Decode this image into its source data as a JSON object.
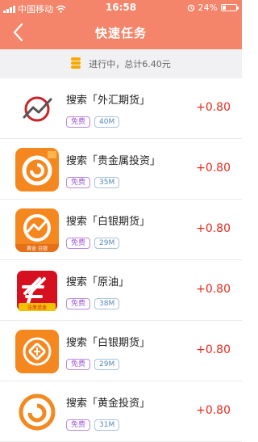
{
  "status_bar": {
    "carrier": "中国移动",
    "time": "16:58",
    "battery": "24%",
    "battery_level": 0.24
  },
  "nav": {
    "title": "快速任务"
  },
  "summary": {
    "text": "进行中，总计6.40元"
  },
  "colors": {
    "header": "#f4856b",
    "reward": "#e8291d",
    "tag_free": "#a05ad6",
    "tag_size": "#5a8ab8"
  },
  "tasks": [
    {
      "icon": "forex-futures-icon",
      "title": "搜索「外汇期货」",
      "tag_free": "免费",
      "size": "40M",
      "reward": "+0.80"
    },
    {
      "icon": "precious-metal-icon",
      "title": "搜索「贵金属投资」",
      "tag_free": "免费",
      "size": "35M",
      "reward": "+0.80"
    },
    {
      "icon": "silver-futures-icon",
      "title": "搜索「白银期货」",
      "tag_free": "免费",
      "size": "29M",
      "reward": "+0.80",
      "icon_caption": "黄金 白银"
    },
    {
      "icon": "crude-oil-icon",
      "title": "搜索「原油」",
      "tag_free": "免费",
      "size": "38M",
      "reward": "+0.80",
      "icon_caption": "注册送金"
    },
    {
      "icon": "silver-futures-icon",
      "title": "搜索「白银期货」",
      "tag_free": "免费",
      "size": "29M",
      "reward": "+0.80"
    },
    {
      "icon": "gold-investment-icon",
      "title": "搜索「黄金投资」",
      "tag_free": "免费",
      "size": "31M",
      "reward": "+0.80"
    }
  ]
}
